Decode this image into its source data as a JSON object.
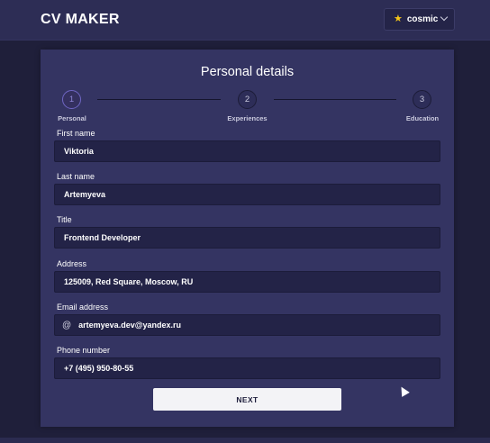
{
  "header": {
    "brand": "CV MAKER",
    "theme": {
      "label": "cosmic",
      "icon": "star-icon"
    }
  },
  "card": {
    "title": "Personal details"
  },
  "stepper": {
    "steps": [
      {
        "number": "1",
        "label": "Personal",
        "active": true
      },
      {
        "number": "2",
        "label": "Experiences",
        "active": false
      },
      {
        "number": "3",
        "label": "Education",
        "active": false
      }
    ]
  },
  "form": {
    "first_name": {
      "label": "First name",
      "value": "Viktoria"
    },
    "last_name": {
      "label": "Last name",
      "value": "Artemyeva"
    },
    "title": {
      "label": "Title",
      "value": "Frontend Developer"
    },
    "address": {
      "label": "Address",
      "value": "125009, Red Square, Moscow, RU"
    },
    "email": {
      "label": "Email address",
      "value": "artemyeva.dev@yandex.ru",
      "icon": "at-icon"
    },
    "phone": {
      "label": "Phone number",
      "value": "+7 (495) 950-80-55"
    },
    "next_label": "NEXT"
  },
  "colors": {
    "background": "#1f1f3a",
    "header": "#2d2d55",
    "card": "#343462",
    "input": "#232347",
    "accent": "#6f66c4",
    "star": "#f5c518"
  }
}
